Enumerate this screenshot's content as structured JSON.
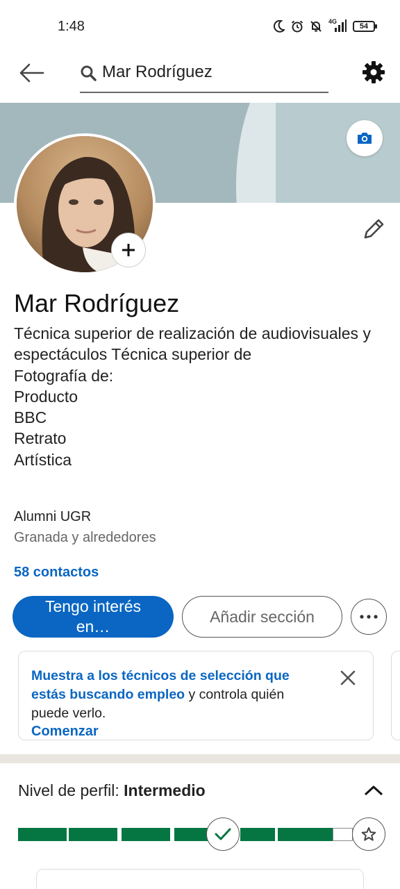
{
  "status_bar": {
    "time": "1:48",
    "network": "4G",
    "battery": "54",
    "icons": [
      "moon-icon",
      "alarm-icon",
      "bell-off-icon",
      "signal-icon",
      "battery-icon"
    ]
  },
  "top_bar": {
    "back_icon": "arrow-left-icon",
    "search_icon": "search-icon",
    "search_value": "Mar Rodríguez",
    "settings_icon": "gear-icon"
  },
  "banner": {
    "camera_icon": "camera-icon"
  },
  "profile": {
    "name": "Mar Rodríguez",
    "headline": "Técnica superior de realización de audiovisuales y espectáculos Técnica superior de\nFotografía de:\nProducto\nBBC\nRetrato\nArtística",
    "school": "Alumni UGR",
    "location": "Granada y alrededores",
    "contacts": "58 contactos",
    "add_photo_icon": "plus-icon",
    "edit_icon": "pencil-icon"
  },
  "actions": {
    "primary_label": "Tengo interés en…",
    "secondary_label": "Añadir sección",
    "more_icon": "ellipsis-icon"
  },
  "promo": {
    "highlight": "Muestra a los técnicos de selección que estás buscando empleo",
    "rest": " y controla quién puede verlo.",
    "cta": "Comenzar",
    "close_icon": "close-icon"
  },
  "profile_level": {
    "label": "Nivel de perfil: ",
    "value": "Intermedio",
    "collapse_icon": "chevron-up-icon",
    "progress_fraction": 0.94,
    "check_icon": "check-icon",
    "star_icon": "star-icon"
  },
  "colors": {
    "brand_blue": "#0a66c2",
    "progress_green": "#057642",
    "banner": "#a3b8bd",
    "divider": "#e9e5df"
  }
}
